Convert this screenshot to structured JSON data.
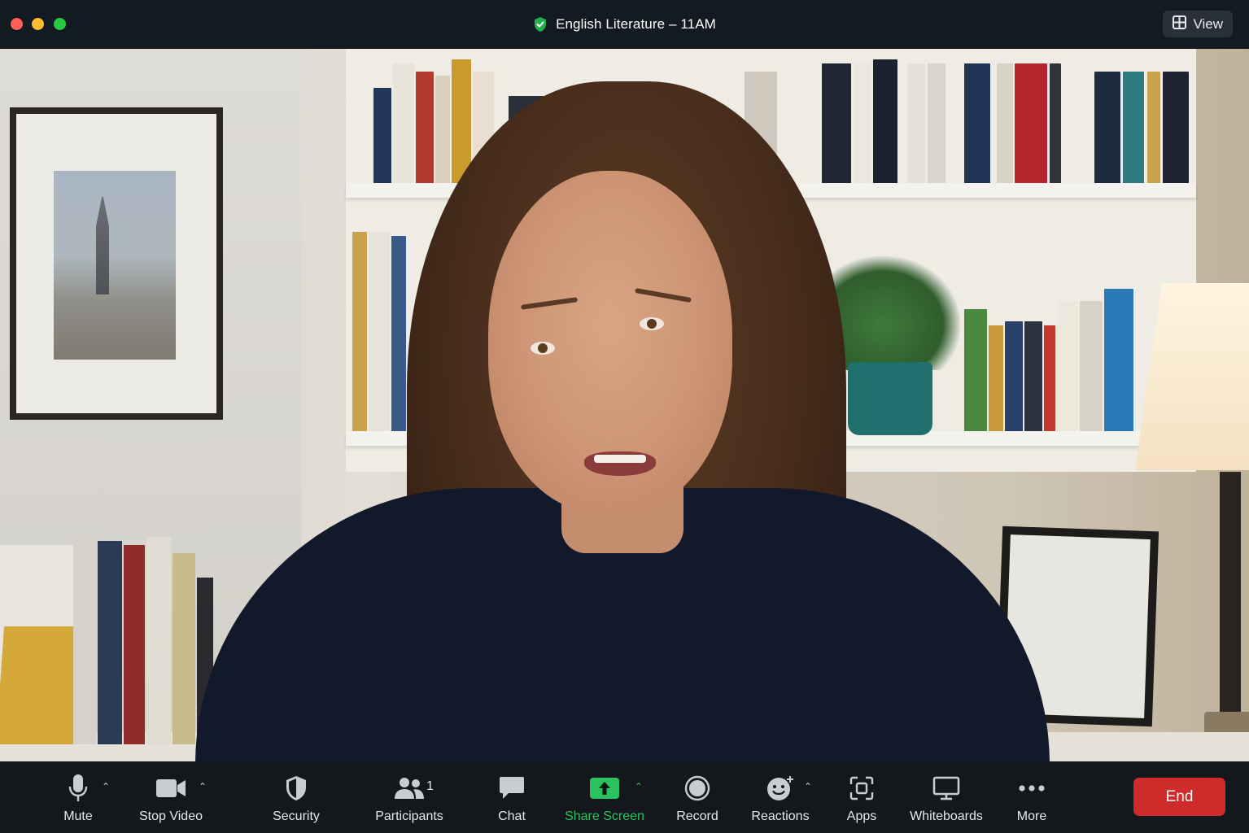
{
  "window": {
    "title": "English Literature – 11AM",
    "view_label": "View"
  },
  "toolbar": {
    "mute_label": "Mute",
    "stop_video_label": "Stop Video",
    "security_label": "Security",
    "participants_label": "Participants",
    "participants_count": "1",
    "chat_label": "Chat",
    "share_screen_label": "Share Screen",
    "record_label": "Record",
    "reactions_label": "Reactions",
    "apps_label": "Apps",
    "whiteboards_label": "Whiteboards",
    "more_label": "More",
    "end_label": "End"
  },
  "colors": {
    "share_accent": "#29c25f",
    "end_button": "#d02b2b",
    "secure_shield": "#22b04b"
  },
  "icons": [
    "secure-shield-icon",
    "view-grid-icon",
    "microphone-icon",
    "video-camera-icon",
    "security-shield-icon",
    "participants-icon",
    "chat-bubble-icon",
    "share-screen-icon",
    "record-icon",
    "reactions-icon",
    "apps-icon",
    "whiteboard-icon",
    "more-dots-icon"
  ]
}
